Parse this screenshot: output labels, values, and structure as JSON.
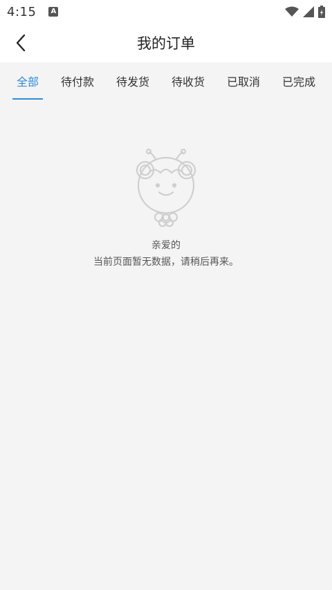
{
  "status": {
    "time": "4:15",
    "notification_icon": "a-box-icon",
    "wifi_icon": "wifi-icon",
    "signal_icon": "signal-icon",
    "battery_icon": "battery-icon"
  },
  "header": {
    "title": "我的订单",
    "back_icon": "chevron-left-icon"
  },
  "tabs": [
    {
      "label": "全部",
      "active": true
    },
    {
      "label": "待付款",
      "active": false
    },
    {
      "label": "待发货",
      "active": false
    },
    {
      "label": "待收货",
      "active": false
    },
    {
      "label": "已取消",
      "active": false
    },
    {
      "label": "已完成",
      "active": false
    }
  ],
  "empty_state": {
    "illustration": "empty-mascot-icon",
    "line1": "亲爱的",
    "line2": "当前页面暂无数据，请稍后再来。"
  },
  "colors": {
    "accent": "#2c8be0",
    "background": "#f4f4f4"
  }
}
